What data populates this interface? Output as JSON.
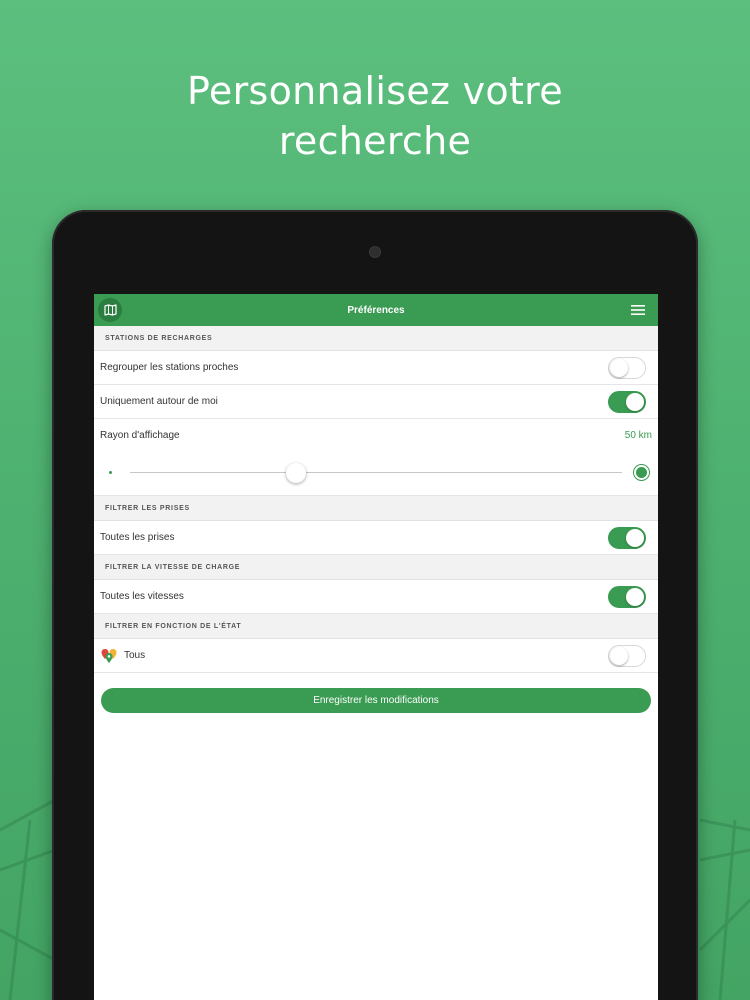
{
  "headline": {
    "line1": "Personnalisez votre",
    "line2": "recherche"
  },
  "app": {
    "title": "Préférences",
    "icons": {
      "left": "map-icon",
      "right": "hamburger-menu-icon"
    },
    "accent_color": "#3a9b52"
  },
  "sections": {
    "stations": {
      "header": "STATIONS DE RECHARGES",
      "regrouper": {
        "label": "Regrouper les stations proches",
        "on": false
      },
      "autour": {
        "label": "Uniquement autour de moi",
        "on": true
      },
      "rayon": {
        "label": "Rayon d'affichage",
        "value": "50 km",
        "slider_fraction": 0.33
      }
    },
    "prises": {
      "header": "FILTRER LES PRISES",
      "toutes": {
        "label": "Toutes les prises",
        "on": true
      }
    },
    "vitesse": {
      "header": "FILTRER LA VITESSE DE CHARGE",
      "toutes": {
        "label": "Toutes les vitesses",
        "on": true
      }
    },
    "etat": {
      "header": "FILTRER EN FONCTION DE L'ÉTAT",
      "tous": {
        "label": "Tous",
        "on": false,
        "icon": "status-pins-icon"
      }
    }
  },
  "save_button": "Enregistrer les modifications"
}
